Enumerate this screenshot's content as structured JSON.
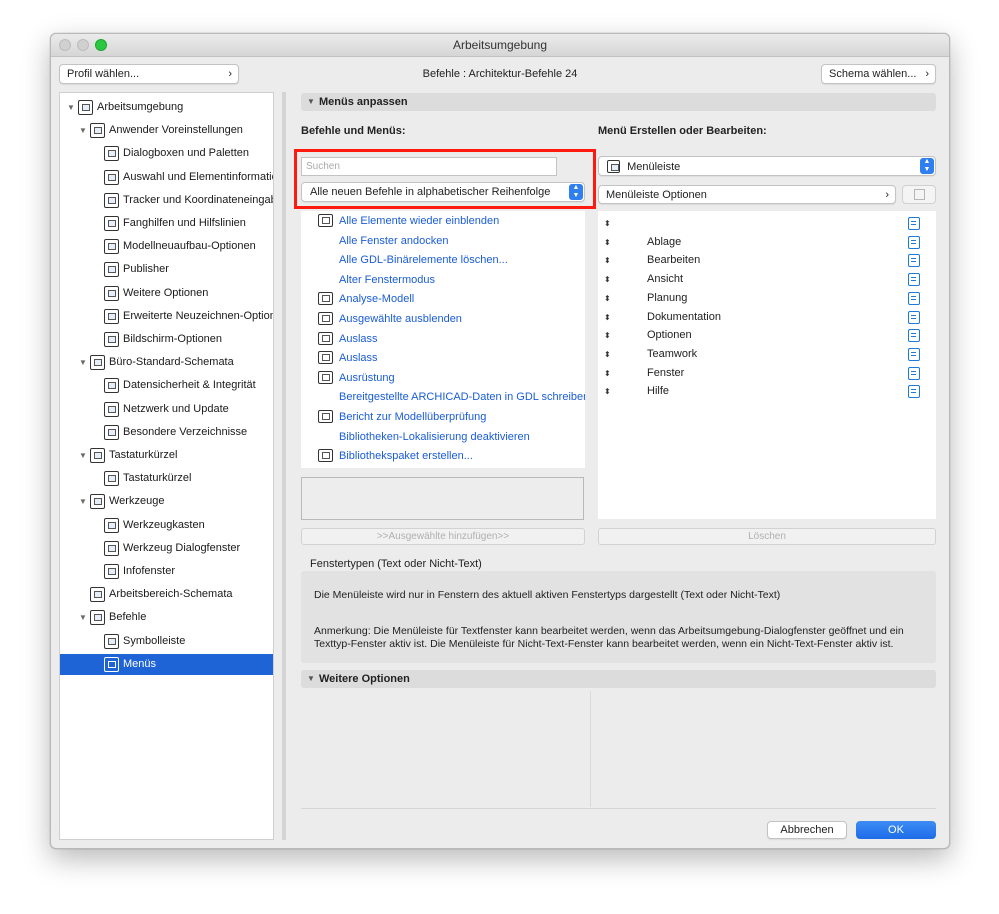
{
  "window": {
    "title": "Arbeitsumgebung"
  },
  "header": {
    "profile_button": "Profil wählen...",
    "commands_label": "Befehle :",
    "commands_value": "Architektur-Befehle 24",
    "schema_button": "Schema wählen..."
  },
  "tree": [
    {
      "label": "Arbeitsumgebung",
      "level": 0,
      "expanded": true
    },
    {
      "label": "Anwender Voreinstellungen",
      "level": 1,
      "expanded": true
    },
    {
      "label": "Dialogboxen und Paletten",
      "level": 2
    },
    {
      "label": "Auswahl und Elementinformation",
      "level": 2
    },
    {
      "label": "Tracker und Koordinateneingabe",
      "level": 2
    },
    {
      "label": "Fanghilfen und Hilfslinien",
      "level": 2
    },
    {
      "label": "Modellneuaufbau-Optionen",
      "level": 2
    },
    {
      "label": "Publisher",
      "level": 2
    },
    {
      "label": "Weitere Optionen",
      "level": 2
    },
    {
      "label": "Erweiterte Neuzeichnen-Optionen",
      "level": 2
    },
    {
      "label": "Bildschirm-Optionen",
      "level": 2
    },
    {
      "label": "Büro-Standard-Schemata",
      "level": 1,
      "expanded": true
    },
    {
      "label": "Datensicherheit & Integrität",
      "level": 2
    },
    {
      "label": "Netzwerk und Update",
      "level": 2
    },
    {
      "label": "Besondere Verzeichnisse",
      "level": 2
    },
    {
      "label": "Tastaturkürzel",
      "level": 1,
      "expanded": true
    },
    {
      "label": "Tastaturkürzel",
      "level": 2
    },
    {
      "label": "Werkzeuge",
      "level": 1,
      "expanded": true
    },
    {
      "label": "Werkzeugkasten",
      "level": 2
    },
    {
      "label": "Werkzeug Dialogfenster",
      "level": 2
    },
    {
      "label": "Infofenster",
      "level": 2
    },
    {
      "label": "Arbeitsbereich-Schemata",
      "level": 1
    },
    {
      "label": "Befehle",
      "level": 1,
      "expanded": true
    },
    {
      "label": "Symbolleiste",
      "level": 2
    },
    {
      "label": "Menüs",
      "level": 2,
      "selected": true
    }
  ],
  "menus_section": {
    "title": "Menüs anpassen",
    "left_heading": "Befehle und Menüs:",
    "right_heading": "Menü Erstellen oder Bearbeiten:",
    "search_placeholder": "Suchen",
    "sort_select": "Alle neuen Befehle in alphabetischer Reihenfolge",
    "commands": [
      {
        "label": "Alle Elemente wieder einblenden",
        "icon": true
      },
      {
        "label": "Alle Fenster andocken",
        "icon": false
      },
      {
        "label": "Alle GDL-Binärelemente löschen...",
        "icon": false
      },
      {
        "label": "Alter Fenstermodus",
        "icon": false
      },
      {
        "label": "Analyse-Modell",
        "icon": true
      },
      {
        "label": "Ausgewählte ausblenden",
        "icon": true
      },
      {
        "label": "Auslass",
        "icon": true
      },
      {
        "label": "Auslass",
        "icon": true
      },
      {
        "label": "Ausrüstung",
        "icon": true
      },
      {
        "label": "Bereitgestellte ARCHICAD-Daten in GDL schreiben",
        "icon": false
      },
      {
        "label": "Bericht zur Modellüberprüfung",
        "icon": true
      },
      {
        "label": "Bibliotheken-Lokalisierung deaktivieren",
        "icon": false
      },
      {
        "label": "Bibliothekspaket erstellen...",
        "icon": true
      }
    ],
    "add_button": ">>Ausgewählte hinzufügen>>",
    "menu_select": "Menüleiste",
    "menu_options": "Menüleiste Optionen",
    "menu_items": [
      "",
      "Ablage",
      "Bearbeiten",
      "Ansicht",
      "Planung",
      "Dokumentation",
      "Optionen",
      "Teamwork",
      "Fenster",
      "Hilfe"
    ],
    "delete_button": "Löschen"
  },
  "info": {
    "label": "Fenstertypen (Text oder Nicht-Text)",
    "text1": "Die Menüleiste wird nur in Fenstern des aktuell aktiven Fenstertyps dargestellt (Text oder Nicht-Text)",
    "text2": "Anmerkung: Die Menüleiste für Textfenster kann bearbeitet werden, wenn das Arbeitsumgebung-Dialogfenster geöffnet und ein Texttyp-Fenster aktiv ist. Die Menüleiste für Nicht-Text-Fenster kann bearbeitet werden, wenn ein Nicht-Text-Fenster aktiv ist."
  },
  "more_section": {
    "title": "Weitere Optionen"
  },
  "footer": {
    "cancel": "Abbrechen",
    "ok": "OK"
  },
  "colors": {
    "selection": "#1f64d6",
    "link": "#1a5cd6",
    "highlight_frame": "#ff1a10",
    "ok_button": "#2a77ef"
  }
}
